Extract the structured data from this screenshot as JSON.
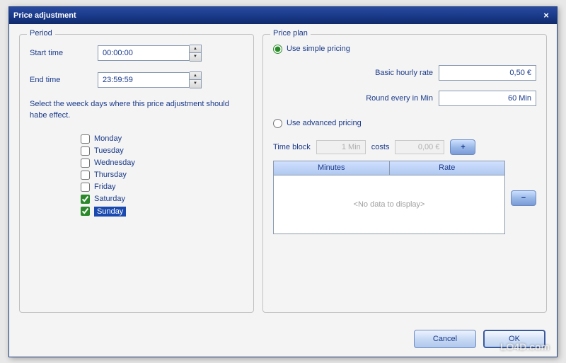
{
  "window": {
    "title": "Price adjustment"
  },
  "period": {
    "legend": "Period",
    "start_label": "Start time",
    "start_value": "00:00:00",
    "end_label": "End time",
    "end_value": "23:59:59",
    "help": "Select the weeck days where this price adjustment should habe effect.",
    "days": [
      {
        "label": "Monday",
        "checked": false
      },
      {
        "label": "Tuesday",
        "checked": false
      },
      {
        "label": "Wednesday",
        "checked": false
      },
      {
        "label": "Thursday",
        "checked": false
      },
      {
        "label": "Friday",
        "checked": false
      },
      {
        "label": "Saturday",
        "checked": true
      },
      {
        "label": "Sunday",
        "checked": true,
        "selected": true
      }
    ]
  },
  "plan": {
    "legend": "Price plan",
    "simple_label": "Use simple pricing",
    "basic_rate_label": "Basic hourly rate",
    "basic_rate_value": "0,50 €",
    "round_label": "Round every in Min",
    "round_value": "60 Min",
    "advanced_label": "Use advanced pricing",
    "time_block_label": "Time block",
    "time_block_value": "1 Min",
    "costs_label": "costs",
    "costs_value": "0,00 €",
    "grid": {
      "col_minutes": "Minutes",
      "col_rate": "Rate",
      "empty": "<No data to display>"
    },
    "selected": "simple"
  },
  "footer": {
    "cancel": "Cancel",
    "ok": "OK"
  },
  "watermark": "LO4D.com"
}
